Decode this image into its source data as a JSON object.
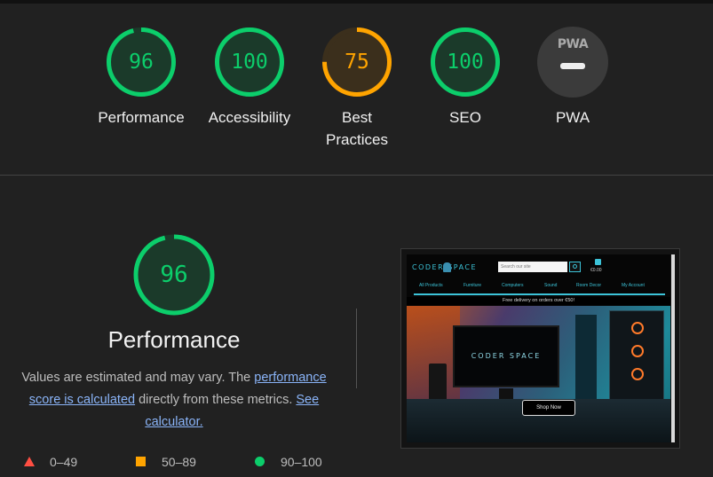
{
  "summary": {
    "gauges": [
      {
        "score": "96",
        "label": "Performance",
        "color": "#0cce6b",
        "fraction": 0.96
      },
      {
        "score": "100",
        "label": "Accessibility",
        "color": "#0cce6b",
        "fraction": 1.0
      },
      {
        "score": "75",
        "label": "Best Practices",
        "color": "#ffa400",
        "fraction": 0.75
      },
      {
        "score": "100",
        "label": "SEO",
        "color": "#0cce6b",
        "fraction": 1.0
      }
    ],
    "pwa": {
      "badge": "PWA",
      "label": "PWA"
    }
  },
  "performance": {
    "score": "96",
    "fraction": 0.96,
    "title": "Performance",
    "desc_1": "Values are estimated and may vary. The ",
    "desc_link_1": "performance score is calculated",
    "desc_2": " directly from these metrics. ",
    "desc_link_2": "See calculator."
  },
  "legend": {
    "fail": "0–49",
    "average": "50–89",
    "pass": "90–100",
    "fail_color": "#ff4e42",
    "average_color": "#ffa400",
    "pass_color": "#0cce6b"
  },
  "screenshot": {
    "logo": "CODER   SPACE",
    "search_placeholder": "Search our site",
    "price": "€0.00",
    "nav": [
      "All Products",
      "Furniture",
      "Computers",
      "Sound",
      "Room Decor",
      "My Account"
    ],
    "banner": "Free delivery on orders over €50!",
    "monitor_text": "CODER   SPACE",
    "cta": "Shop Now"
  }
}
